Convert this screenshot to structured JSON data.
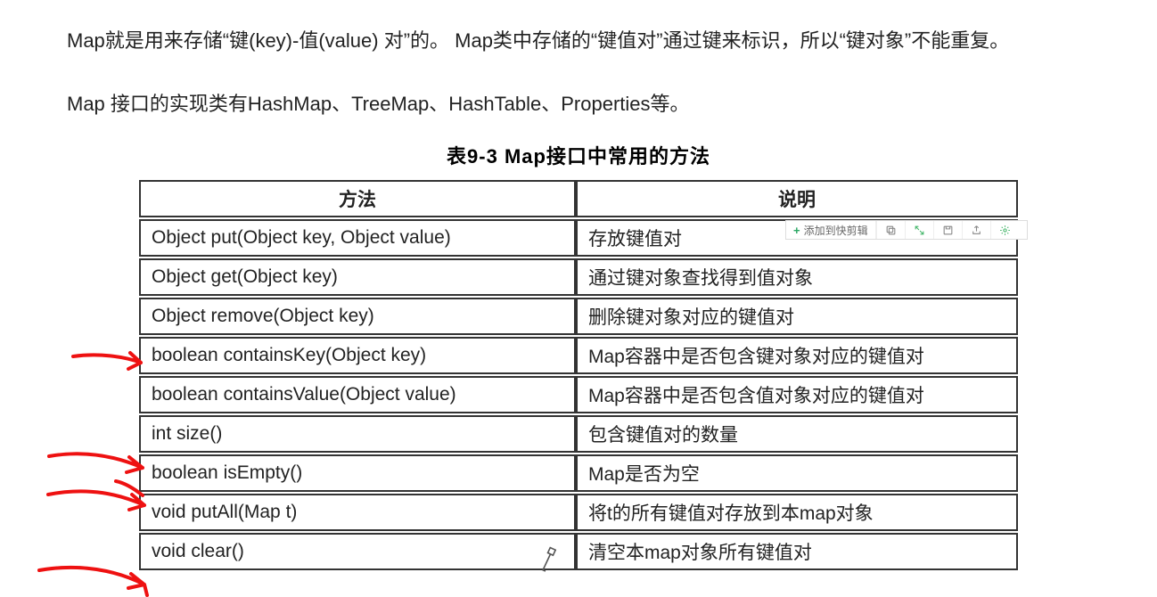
{
  "paragraphs": {
    "p1": "Map就是用来存储“键(key)-值(value) 对”的。 Map类中存储的“键值对”通过键来标识，所以“键对象”不能重复。",
    "p2": "Map 接口的实现类有HashMap、TreeMap、HashTable、Properties等。"
  },
  "table": {
    "caption": "表9-3 Map接口中常用的方法",
    "headers": {
      "method": "方法",
      "desc": "说明"
    },
    "rows": [
      {
        "method": "Object put(Object key, Object value)",
        "desc": "存放键值对"
      },
      {
        "method": "Object get(Object key)",
        "desc": "通过键对象查找得到值对象"
      },
      {
        "method": "Object remove(Object key)",
        "desc": "删除键对象对应的键值对"
      },
      {
        "method": "boolean containsKey(Object key)",
        "desc": "Map容器中是否包含键对象对应的键值对"
      },
      {
        "method": "boolean containsValue(Object value)",
        "desc": "Map容器中是否包含值对象对应的键值对"
      },
      {
        "method": "int size()",
        "desc": "包含键值对的数量"
      },
      {
        "method": "boolean isEmpty()",
        "desc": "Map是否为空"
      },
      {
        "method": "void putAll(Map t)",
        "desc": "将t的所有键值对存放到本map对象"
      },
      {
        "method": "void clear()",
        "desc": "清空本map对象所有键值对"
      }
    ]
  },
  "toolbar": {
    "add_label": "添加到快剪辑"
  },
  "annotation_arrows": [
    {
      "row_index": 2
    },
    {
      "row_index": 5
    },
    {
      "row_index": 6
    },
    {
      "row_index": 8
    }
  ]
}
